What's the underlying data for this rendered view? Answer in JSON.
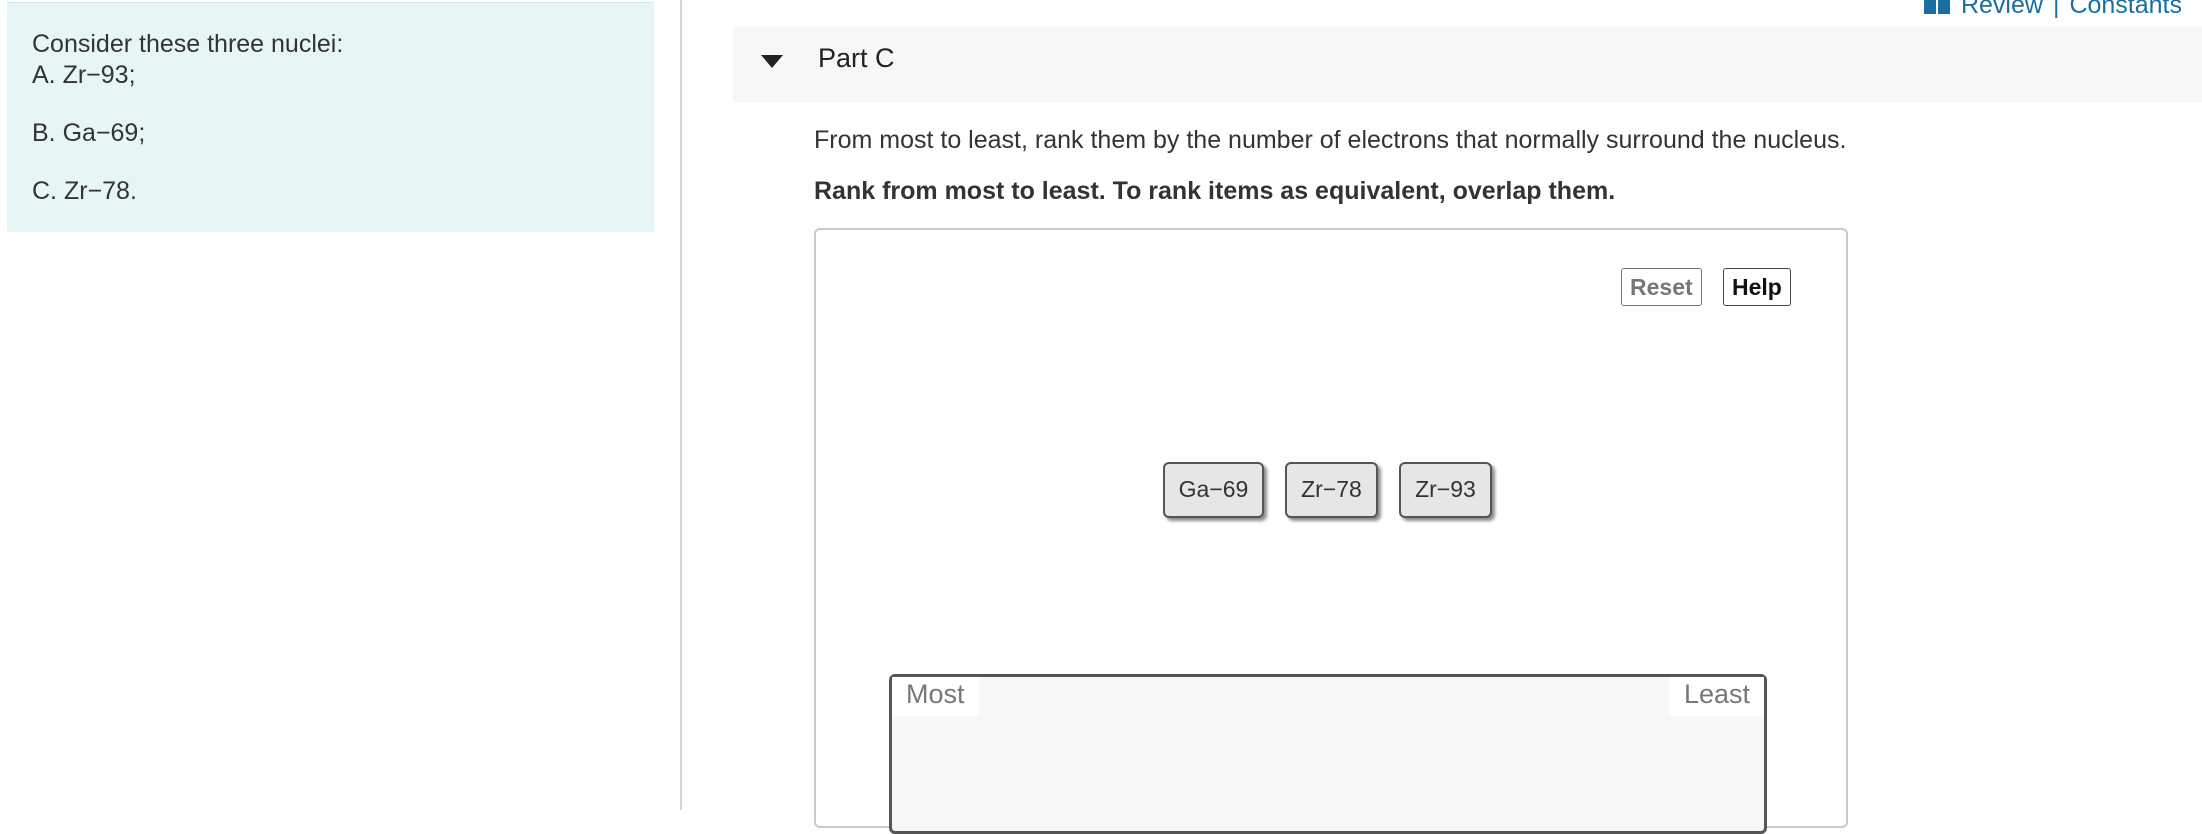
{
  "prompt": {
    "intro": "Consider these three nuclei:",
    "items": [
      "A. Zr−93;",
      "B. Ga−69;",
      "C. Zr−78."
    ]
  },
  "toplinks": {
    "icon": "book-icon",
    "review": "Review",
    "separator": "|",
    "constants": "Constants"
  },
  "part": {
    "title": "Part C",
    "question": "From most to least, rank them by the number of electrons that normally surround the nucleus.",
    "instruction": "Rank from most to least. To rank items as equivalent, overlap them."
  },
  "ranking": {
    "reset_label": "Reset",
    "help_label": "Help",
    "chips": [
      "Ga−69",
      "Zr−78",
      "Zr−93"
    ],
    "most_label": "Most",
    "least_label": "Least"
  },
  "colors": {
    "prompt_bg": "#e6f6f7",
    "link": "#1a6fa0",
    "header_bg": "#f7f7f7",
    "chip_bg": "#e6e6e6"
  }
}
